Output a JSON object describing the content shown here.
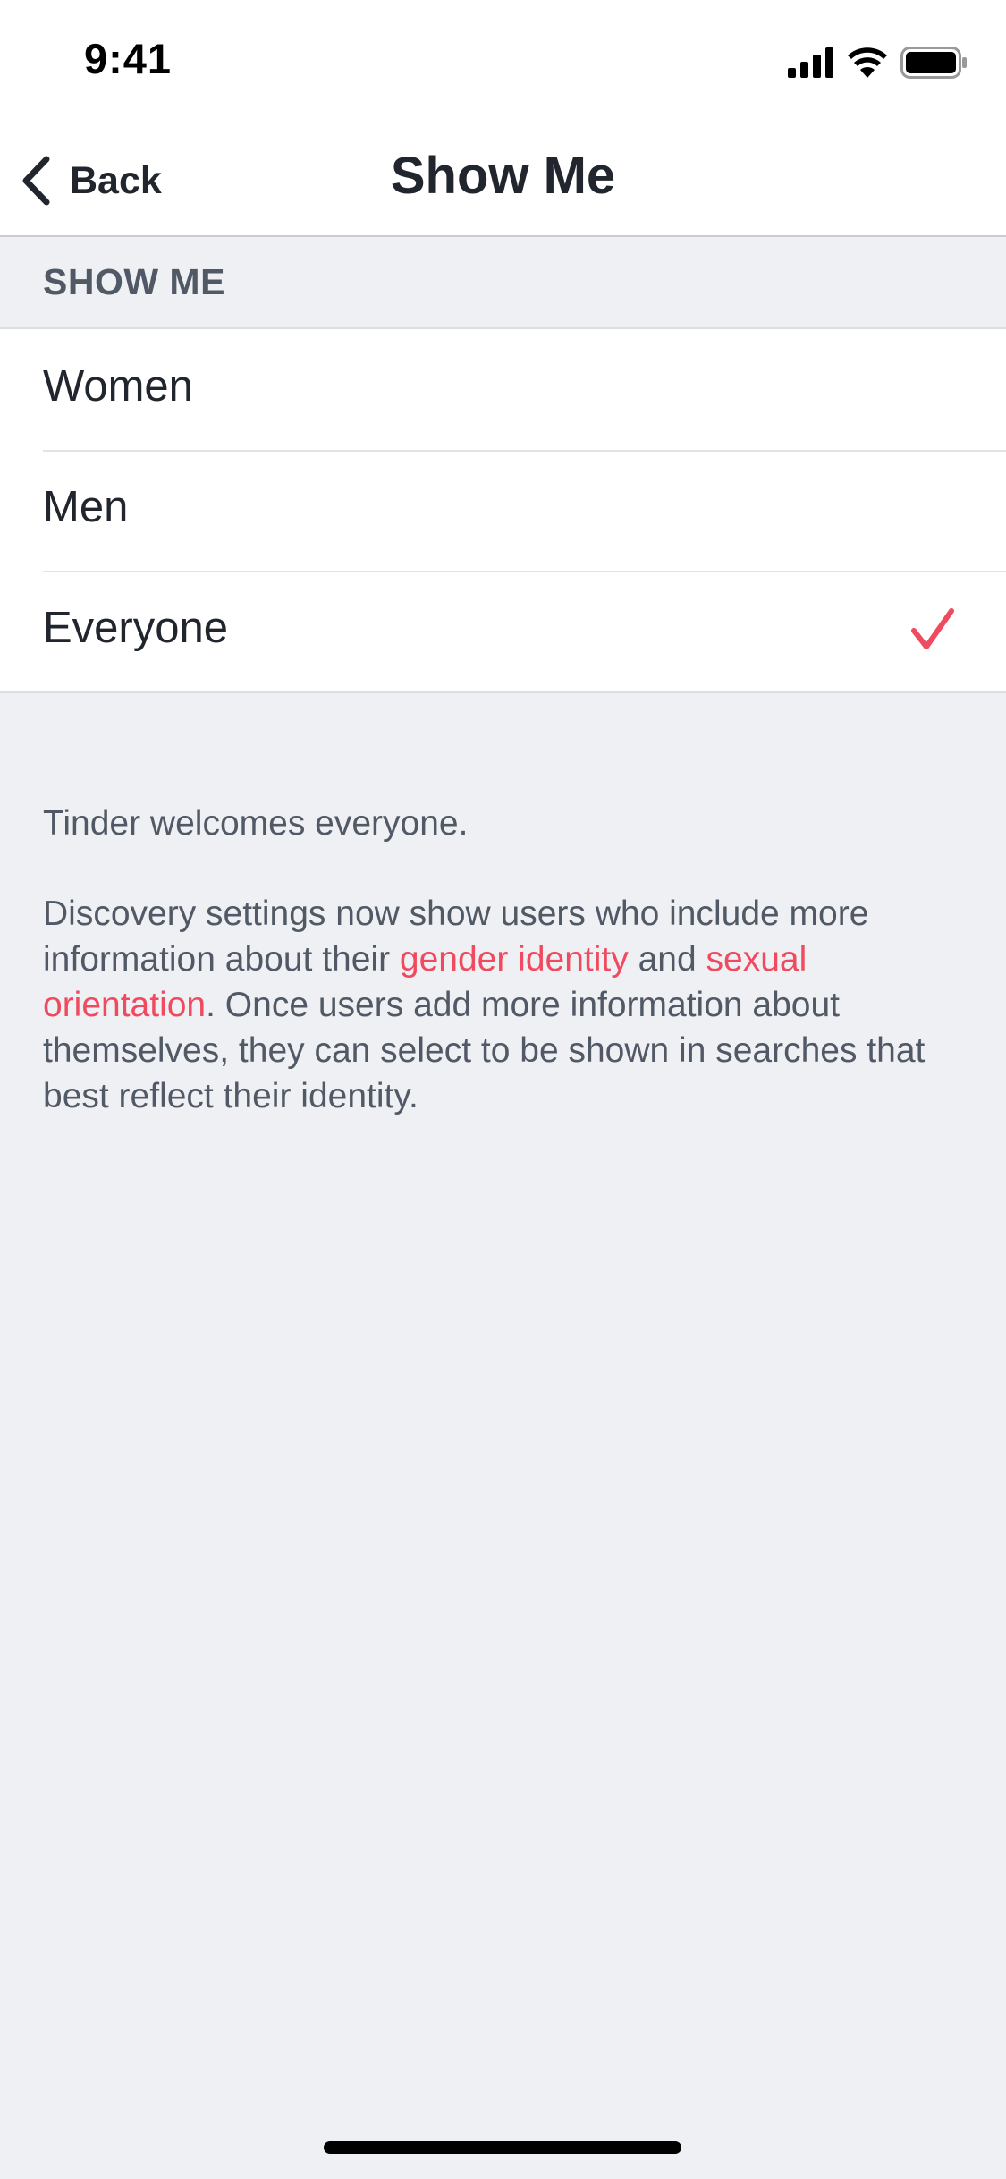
{
  "status_bar": {
    "time": "9:41",
    "icons": [
      "cellular-signal-icon",
      "wifi-icon",
      "battery-icon"
    ]
  },
  "nav": {
    "back_label": "Back",
    "title": "Show Me"
  },
  "section": {
    "header": "SHOW ME"
  },
  "options": [
    {
      "label": "Women",
      "selected": false
    },
    {
      "label": "Men",
      "selected": false
    },
    {
      "label": "Everyone",
      "selected": true
    }
  ],
  "info": {
    "welcome": "Tinder welcomes everyone.",
    "discovery_part1": "Discovery settings now show users who include more information about their ",
    "link_gender": "gender identity",
    "discovery_part2": " and ",
    "link_sexual": "sexual orientation",
    "discovery_part3": ". Once users add more information about themselves, they can select to be shown in searches that best reflect their identity."
  },
  "colors": {
    "accent": "#ef4a5f",
    "background": "#eff0f3",
    "text_primary": "#21262e",
    "text_secondary": "#505965"
  }
}
